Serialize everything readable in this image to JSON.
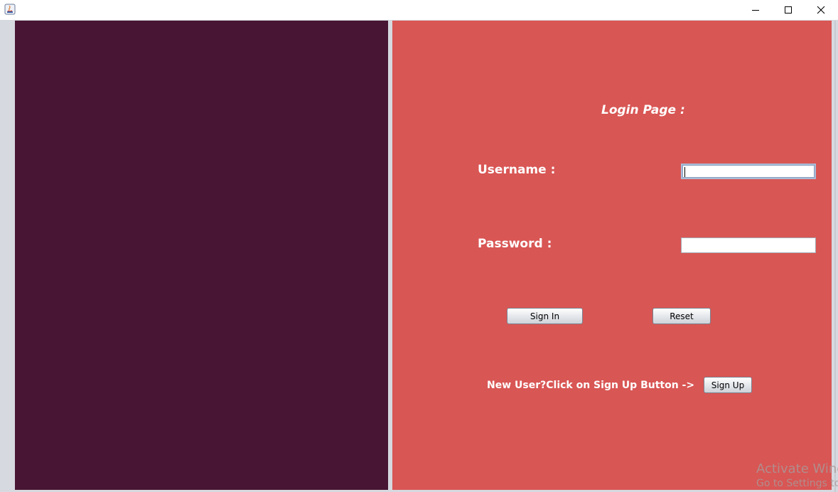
{
  "window": {
    "controls": {
      "minimize_icon": "minimize-icon",
      "maximize_icon": "maximize-icon",
      "close_icon": "close-icon"
    }
  },
  "colors": {
    "left_panel": "#481534",
    "right_panel": "#d85654",
    "frame": "#d6d9df",
    "text": "#ffffff"
  },
  "login": {
    "title": "Login Page :",
    "username_label": "Username :",
    "username_value": "",
    "password_label": "Password :",
    "password_value": "",
    "signin_label": "Sign In",
    "reset_label": "Reset",
    "signup_hint": "New User?Click on Sign Up Button ->",
    "signup_label": "Sign Up"
  },
  "watermark": {
    "line1": "Activate Windows",
    "line2": "Go to Settings to activate Windows."
  }
}
